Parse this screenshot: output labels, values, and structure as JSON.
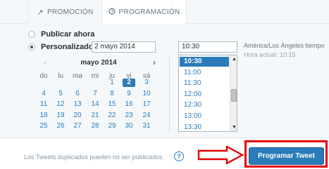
{
  "tabs": [
    {
      "label": "PROMOCIÓN",
      "icon": "arrow-up-right-icon"
    },
    {
      "label": "PROGRAMACIÓN",
      "icon": "clock-icon"
    }
  ],
  "options": {
    "publish_now": "Publicar ahora",
    "custom": "Personalizado",
    "selected": "custom"
  },
  "date_value": "2 mayo 2014",
  "calendar": {
    "month_label": "mayo 2014",
    "prev_icon": "chevron-left-icon",
    "next_icon": "chevron-right-icon",
    "weekdays": [
      "do",
      "lu",
      "ma",
      "mi",
      "ju",
      "vi",
      "sá"
    ],
    "weeks": [
      [
        "",
        "",
        "",
        "",
        "1",
        "2",
        "3"
      ],
      [
        "4",
        "5",
        "6",
        "7",
        "8",
        "9",
        "10"
      ],
      [
        "11",
        "12",
        "13",
        "14",
        "15",
        "16",
        "17"
      ],
      [
        "18",
        "19",
        "20",
        "21",
        "22",
        "23",
        "24"
      ],
      [
        "25",
        "26",
        "27",
        "28",
        "29",
        "30",
        "31"
      ]
    ],
    "selected_day": "2"
  },
  "time": {
    "value": "10:30",
    "options": [
      "10:30",
      "11:00",
      "11:30",
      "12:00",
      "12:30",
      "13:00",
      "13:30"
    ],
    "selected": "10:30"
  },
  "timezone": {
    "name": "América/Los Ángeles tiempo",
    "current": "Hora actual: 10:15"
  },
  "footer": {
    "note": "Los Tweets duplicados pueden no ser publicados.",
    "help": "?"
  },
  "button": {
    "label": "Programar Tweet"
  },
  "colors": {
    "accent": "#2b7bb9",
    "annotation": "#e60000"
  }
}
